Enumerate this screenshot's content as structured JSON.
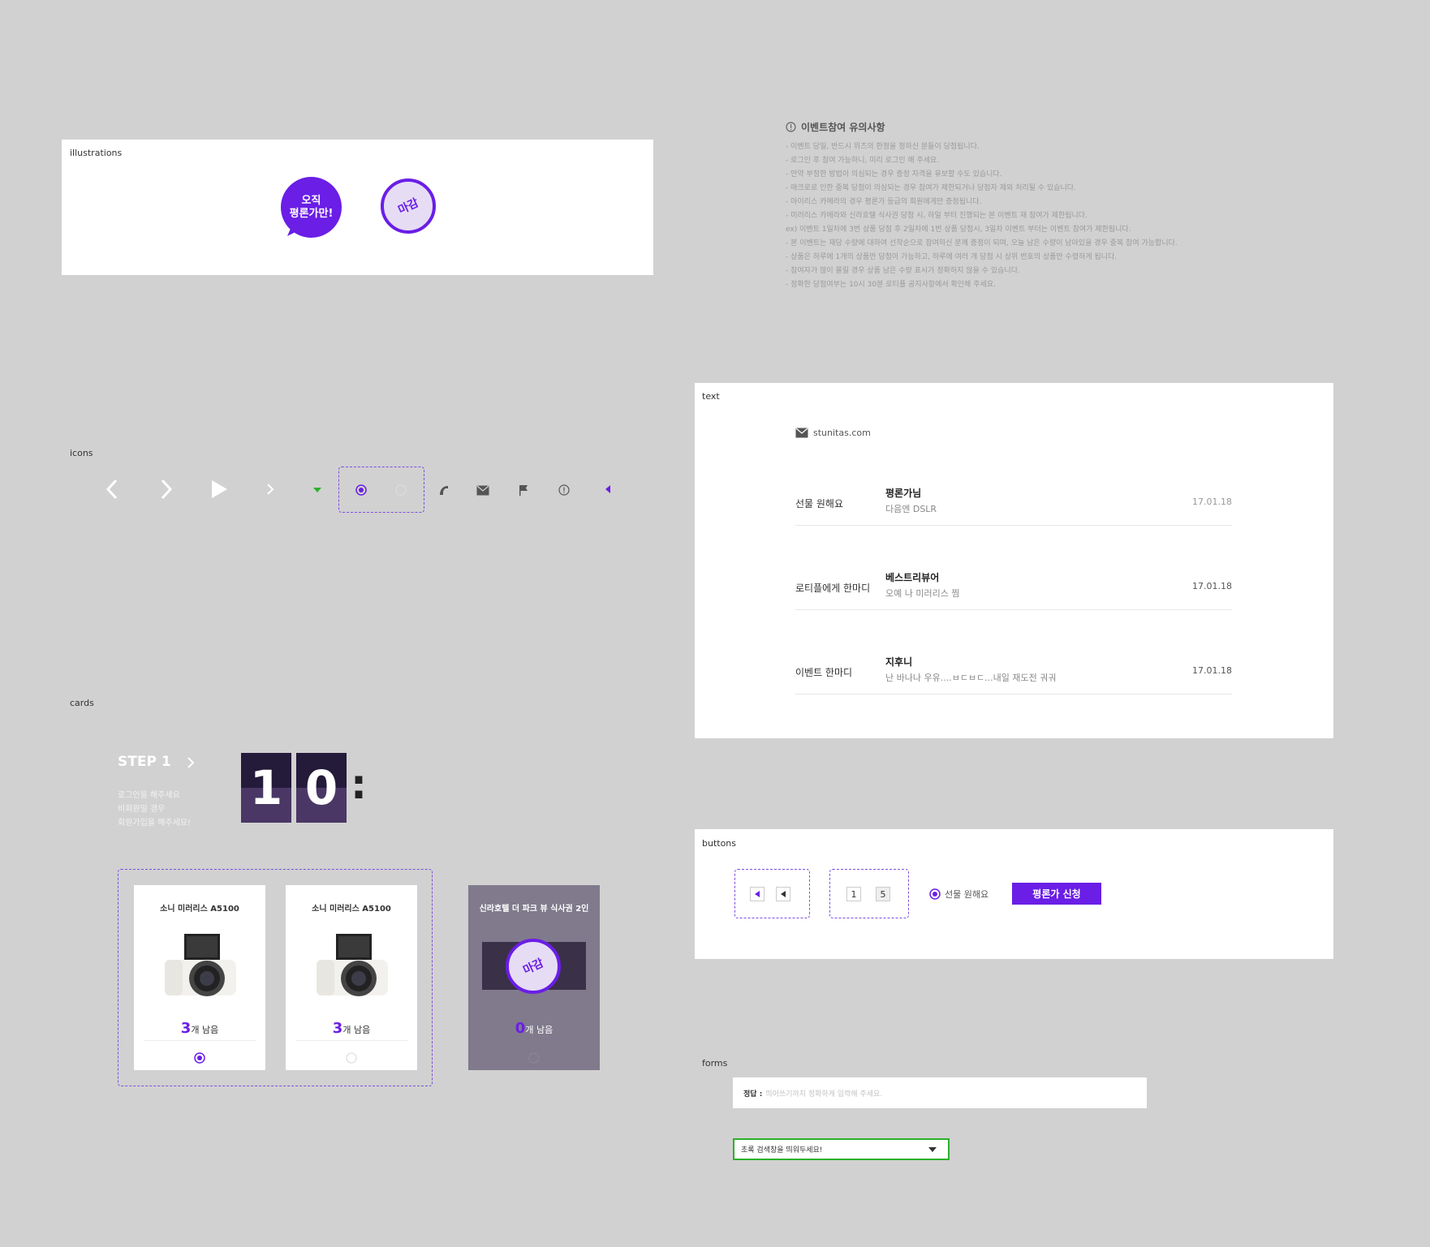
{
  "sections": {
    "illustrations": "illustrations",
    "icons": "icons",
    "cards": "cards",
    "text": "text",
    "buttons": "buttons",
    "forms": "forms"
  },
  "illustrations": {
    "bubble_line1": "오직",
    "bubble_line2": "평론가만!",
    "stamp": "마감"
  },
  "notice": {
    "title": "이벤트참여 유의사항",
    "lines": [
      "- 이벤트 당일, 반드시 위즈의 한정을 정하신 분들이 당첨됩니다.",
      "- 로그인 후 참여 가능하니, 미리 로그인 해 주세요.",
      "- 만약 부정한 방법이 의심되는 경우 증정 자격을 유보할 수도 있습니다.",
      "- 매크로로 인한 중복 당첨이 의심되는 경우 참여가 제한되거나 당첨자 제외 처리될 수 있습니다.",
      "- 마이리스 카메라의 경우 평론가 등급의 회원에게만 증정됩니다.",
      "- 미러리스 카메라와 신라호텔 식사권 당첨 시, 하일 부터 진행되는 본 이벤트 재 참여가 제한됩니다.",
      "  ex) 이벤트 1일차에 3번 상품 당첨 후 2일차에 1번 상품 당첨시, 3일차 이벤트 부터는 이벤트 참여가 제한됩니다.",
      "- 본 이벤트는 재당 수량에 대하여 선착순으로 참여하신 분께 증정이 되며, 오늘 남은 수량이 남아있을 경우 중복 참여 가능합니다.",
      "- 상품은 하루에 1개의 상품만 당첨이 가능하고, 하루에 여러 개 당첨 시 상위 번호의 상품만 수령하게 됩니다.",
      "- 참여자가 많이 몰릴 경우 상품 남은 수량 표시가 정확하지 않을 수 있습니다.",
      "- 정확한 당첨여부는 10시 30분 로티플 공지사항에서 확인해 주세요."
    ]
  },
  "text_panel": {
    "site": "stunitas.com",
    "rows": [
      {
        "label": "선물 원해요",
        "title": "평론가님",
        "sub": "다음엔 DSLR",
        "date": "17.01.18"
      },
      {
        "label": "로티플에게 한마디",
        "title": "베스트리뷰어",
        "sub": "오예 나 미러리스 찜",
        "date": "17.01.18"
      },
      {
        "label": "이벤트 한마디",
        "title": "지후니",
        "sub": "난 바나나 우유....ㅂㄷㅂㄷ...내일 재도전 궈궈",
        "date": "17.01.18"
      }
    ]
  },
  "cards_section": {
    "step_title": "STEP 1",
    "step_desc": [
      "로그인을 해주세요",
      "비회원일 경우",
      "회원가입을 해주세요!"
    ],
    "digits": [
      "1",
      "0"
    ],
    "colon": ":",
    "cards": [
      {
        "title": "소니 미러리스 A5100",
        "count": "3",
        "unit": "개 남음"
      },
      {
        "title": "소니 미러리스 A5100",
        "count": "3",
        "unit": "개 남음"
      },
      {
        "title": "신라호텔 더 파크 뷰 식사권 2인",
        "count": "0",
        "unit": "개 남음",
        "stamp": "마감"
      }
    ]
  },
  "buttons_panel": {
    "page_numbers": [
      "1",
      "5"
    ],
    "radio_label": "선물 원해요",
    "apply_button": "평론가 신청"
  },
  "forms_panel": {
    "answer_label": "정답 :",
    "answer_placeholder": "띄어쓰기까지 정확하게 입력해 주세요.",
    "select_value": "초록 검색창을 띄워두세요!"
  },
  "colors": {
    "accent": "#6a1ee6",
    "green": "#2bb12b",
    "background": "#d1d1d1"
  }
}
